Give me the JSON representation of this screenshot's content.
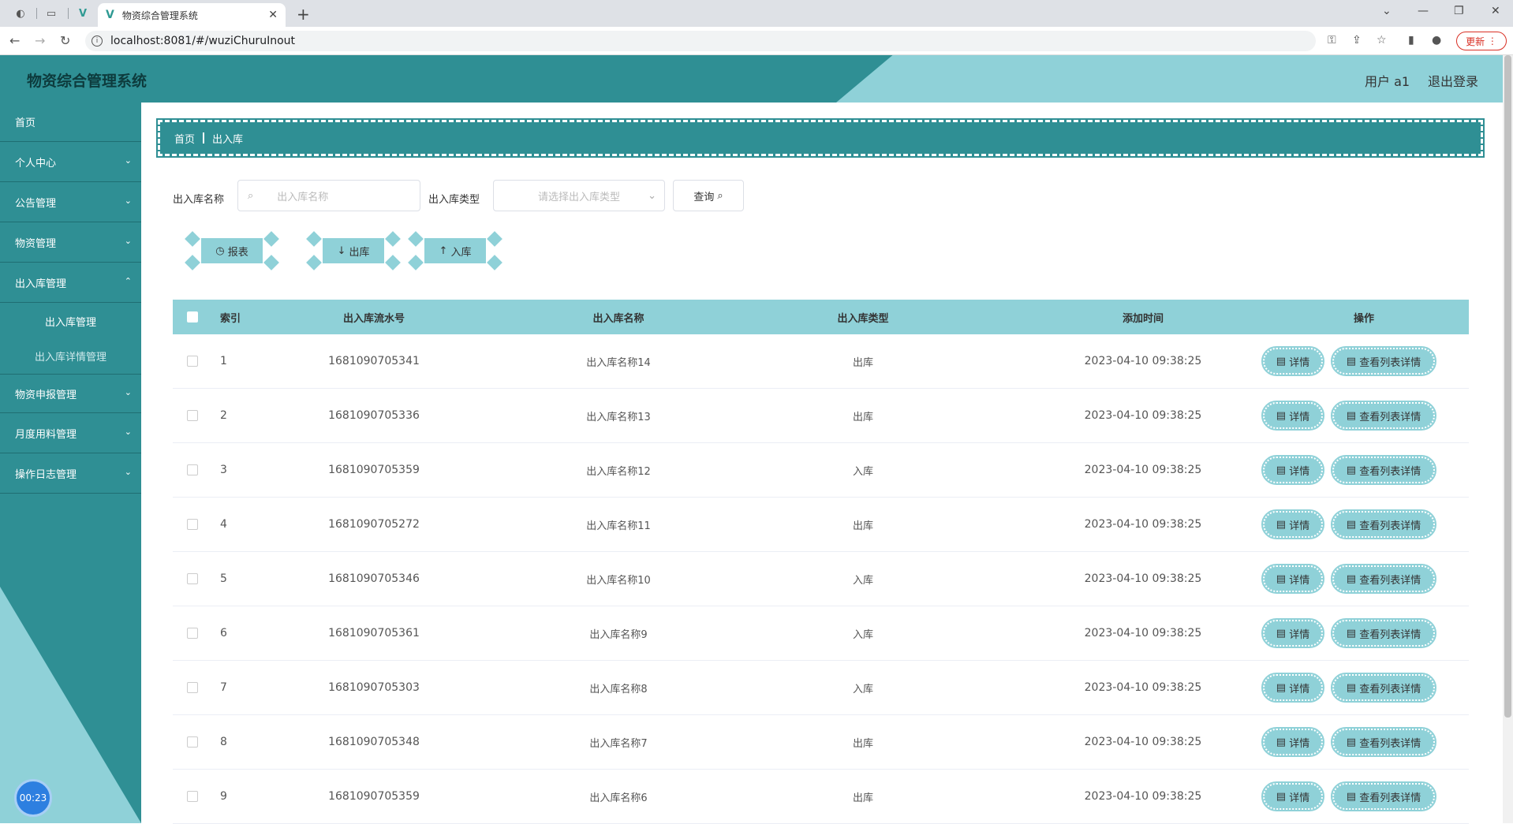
{
  "browser": {
    "tab_title": "物资综合管理系统",
    "url": "localhost:8081/#/wuziChuruInout",
    "update_label": "更新"
  },
  "header": {
    "title": "物资综合管理系统",
    "user": "用户 a1",
    "logout": "退出登录"
  },
  "sidebar": {
    "items": [
      {
        "label": "首页"
      },
      {
        "label": "个人中心"
      },
      {
        "label": "公告管理"
      },
      {
        "label": "物资管理"
      },
      {
        "label": "出入库管理"
      }
    ],
    "sub_items": [
      {
        "label": "出入库管理"
      },
      {
        "label": "出入库详情管理"
      }
    ],
    "items_after": [
      {
        "label": "物资申报管理"
      },
      {
        "label": "月度用料管理"
      },
      {
        "label": "操作日志管理"
      }
    ],
    "timer": "00:23"
  },
  "breadcrumb": {
    "home": "首页",
    "current": "出入库"
  },
  "filters": {
    "name_label": "出入库名称",
    "name_placeholder": "出入库名称",
    "type_label": "出入库类型",
    "type_placeholder": "请选择出入库类型",
    "query_label": "查询"
  },
  "actions": {
    "report": "报表",
    "out": "出库",
    "in": "入库"
  },
  "table": {
    "headers": [
      "索引",
      "出入库流水号",
      "出入库名称",
      "出入库类型",
      "添加时间",
      "操作"
    ],
    "detail_label": "详情",
    "list_detail_label": "查看列表详情",
    "rows": [
      {
        "index": "1",
        "serial": "1681090705341",
        "name": "出入库名称14",
        "type": "出库",
        "time": "2023-04-10 09:38:25"
      },
      {
        "index": "2",
        "serial": "1681090705336",
        "name": "出入库名称13",
        "type": "出库",
        "time": "2023-04-10 09:38:25"
      },
      {
        "index": "3",
        "serial": "1681090705359",
        "name": "出入库名称12",
        "type": "入库",
        "time": "2023-04-10 09:38:25"
      },
      {
        "index": "4",
        "serial": "1681090705272",
        "name": "出入库名称11",
        "type": "出库",
        "time": "2023-04-10 09:38:25"
      },
      {
        "index": "5",
        "serial": "1681090705346",
        "name": "出入库名称10",
        "type": "入库",
        "time": "2023-04-10 09:38:25"
      },
      {
        "index": "6",
        "serial": "1681090705361",
        "name": "出入库名称9",
        "type": "入库",
        "time": "2023-04-10 09:38:25"
      },
      {
        "index": "7",
        "serial": "1681090705303",
        "name": "出入库名称8",
        "type": "入库",
        "time": "2023-04-10 09:38:25"
      },
      {
        "index": "8",
        "serial": "1681090705348",
        "name": "出入库名称7",
        "type": "出库",
        "time": "2023-04-10 09:38:25"
      },
      {
        "index": "9",
        "serial": "1681090705359",
        "name": "出入库名称6",
        "type": "出库",
        "time": "2023-04-10 09:38:25"
      }
    ]
  }
}
